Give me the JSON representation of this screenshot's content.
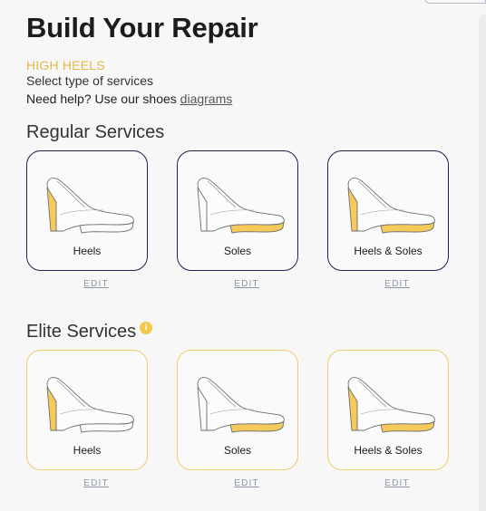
{
  "page": {
    "title": "Build Your Repair",
    "category": "HIGH HEELS",
    "instructions": "Select type of services",
    "help_text": "Need help? Use our shoes ",
    "help_link": "diagrams"
  },
  "regular": {
    "heading": "Regular Services",
    "cards": [
      {
        "label": "Heels",
        "edit": "EDIT",
        "highlight": "heel"
      },
      {
        "label": "Soles",
        "edit": "EDIT",
        "highlight": "sole"
      },
      {
        "label": "Heels & Soles",
        "edit": "EDIT",
        "highlight": "both"
      }
    ]
  },
  "elite": {
    "heading": "Elite Services",
    "info_icon": "i",
    "cards": [
      {
        "label": "Heels",
        "edit": "EDIT",
        "highlight": "heel"
      },
      {
        "label": "Soles",
        "edit": "EDIT",
        "highlight": "sole"
      },
      {
        "label": "Heels & Soles",
        "edit": "EDIT",
        "highlight": "both"
      }
    ]
  },
  "colors": {
    "accent": "#f5c95a",
    "regular_border": "#1f2250",
    "elite_border": "#f0cd6e"
  }
}
